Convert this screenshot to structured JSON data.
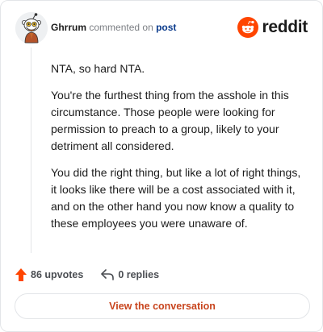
{
  "comment": {
    "username": "Ghrrum",
    "action_text": "commented on",
    "post_link": "post",
    "paragraphs": [
      "NTA, so hard NTA.",
      "You're the furthest thing from the asshole in this circumstance. Those people were looking for permission to preach to a group, likely to your detriment all considered.",
      "You did the right thing, but like a lot of right things, it looks like there will be a cost associated with it, and on the other hand you now know a quality to these employees you were unaware of."
    ]
  },
  "brand": {
    "wordmark": "reddit",
    "color": "#ff4500"
  },
  "actions": {
    "upvotes_label": "86 upvotes",
    "replies_label": "0 replies",
    "upvote_icon": "upvote-arrow-icon",
    "reply_icon": "reply-arrow-icon"
  },
  "cta": {
    "label": "View the conversation",
    "color": "#c8451e"
  }
}
